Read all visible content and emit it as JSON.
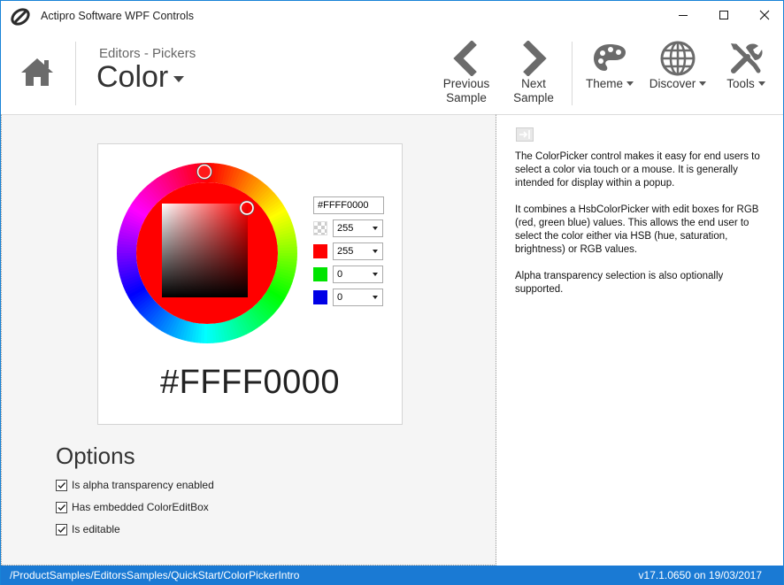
{
  "window": {
    "title": "Actipro Software WPF Controls",
    "controls": [
      "minimize-icon",
      "maximize-icon",
      "close-icon"
    ]
  },
  "header": {
    "breadcrumb": "Editors - Pickers",
    "title": "Color",
    "nav": {
      "previous": {
        "line1": "Previous",
        "line2": "Sample",
        "icon": "chevron-left-icon"
      },
      "next": {
        "line1": "Next",
        "line2": "Sample",
        "icon": "chevron-right-icon"
      },
      "theme": {
        "label": "Theme",
        "icon": "palette-icon"
      },
      "discover": {
        "label": "Discover",
        "icon": "globe-icon"
      },
      "tools": {
        "label": "Tools",
        "icon": "tools-icon"
      }
    }
  },
  "picker": {
    "hex_value": "#FFFF0000",
    "big_hex": "#FFFF0000",
    "channels": [
      {
        "name": "alpha",
        "value": "255",
        "swatch": "checker"
      },
      {
        "name": "red",
        "value": "255",
        "swatch": "#ff0000"
      },
      {
        "name": "green",
        "value": "0",
        "swatch": "#00e400"
      },
      {
        "name": "blue",
        "value": "0",
        "swatch": "#0000e6"
      }
    ],
    "selected_color": "#ff0000"
  },
  "options": {
    "title": "Options",
    "items": [
      {
        "label": "Is alpha transparency enabled",
        "checked": true
      },
      {
        "label": "Has embedded ColorEditBox",
        "checked": true
      },
      {
        "label": "Is editable",
        "checked": true
      }
    ]
  },
  "description": {
    "paragraphs": [
      "The ColorPicker control makes it easy for end users to select a color via touch or a mouse. It is generally intended for display within a popup.",
      "It combines a HsbColorPicker with edit boxes for RGB (red, green blue) values. This allows the end user to select the color either via HSB (hue, saturation, brightness) or RGB values.",
      "Alpha transparency selection is also optionally supported."
    ]
  },
  "status": {
    "path": "/ProductSamples/EditorsSamples/QuickStart/ColorPickerIntro",
    "version": "v17.1.0650 on 19/03/2017"
  },
  "colors": {
    "accent": "#1a7ad4",
    "icon_gray": "#6b6b6b"
  }
}
